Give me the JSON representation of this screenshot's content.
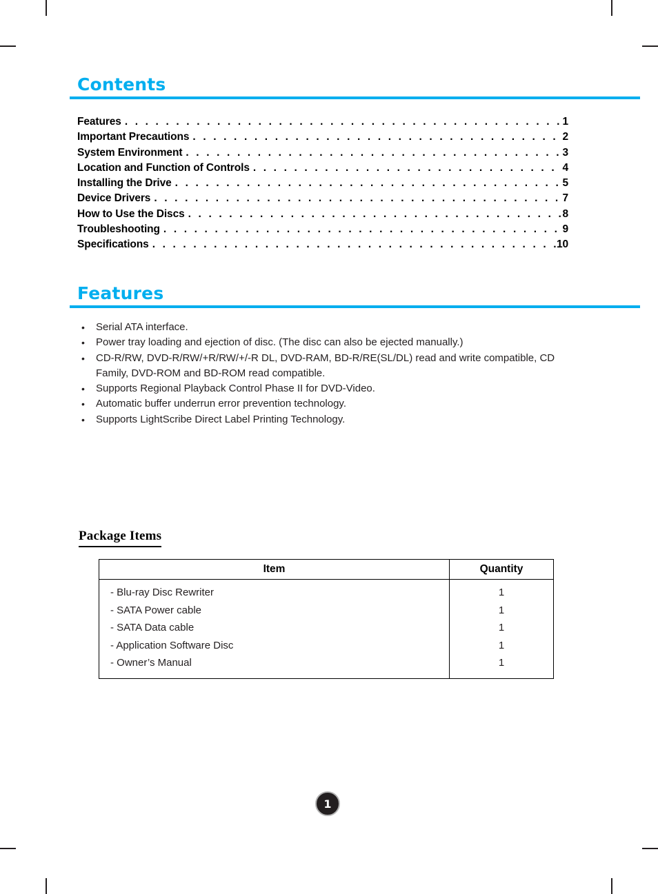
{
  "document": {
    "page_number": "1"
  },
  "contents": {
    "title": "Contents",
    "entries": [
      {
        "label": "Features",
        "dots": ". . . . . . . . . . . . . . . . . . . . . . . . . . . . . . . . . . . . . . . . . . . . . .",
        "page": "1"
      },
      {
        "label": "Important Precautions",
        "dots": ". . . . . . . . . . . . . . . . . . . . . . . . . . . . . . . . . . . . . . . . . . . . . .",
        "page": "2"
      },
      {
        "label": "System Environment",
        "dots": ". . . . . . . . . . . . . . . . . . . . . . . . . . . . . . . . . . . . . . . . . . . . . .",
        "page": "3"
      },
      {
        "label": "Location and Function of Controls",
        "dots": ". . . . . . . . . . . . . . . . . . . . . . . . . . . . . . . . . . . . . . . . . . . . . .",
        "page": "4"
      },
      {
        "label": "Installing the Drive",
        "dots": ". . . . . . . . . . . . . . . . . . . . . . . . . . . . . . . . . . . . . . . . . . . . . .",
        "page": "5"
      },
      {
        "label": "Device Drivers",
        "dots": ". . . . . . . . . . . . . . . . . . . . . . . . . . . . . . . . . . . . . . . . . . . . . .",
        "page": "7"
      },
      {
        "label": "How to Use the Discs",
        "dots": ". . . . . . . . . . . . . . . . . . . . . . . . . . . . . . . . . . . . . . . . . . . . . .",
        "page": "8"
      },
      {
        "label": "Troubleshooting",
        "dots": ". . . . . . . . . . . . . . . . . . . . . . . . . . . . . . . . . . . . . . . . . . . . . .",
        "page": "9"
      },
      {
        "label": "Specifications",
        "dots": ". . . . . . . . . . . . . . . . . . . . . . . . . . . . . . . . . . . . . . . . . . . . . .",
        "page": "10"
      }
    ]
  },
  "features": {
    "title": "Features",
    "bullet_glyph": "•",
    "items": [
      "Serial ATA interface.",
      "Power tray loading and ejection of disc. (The disc can also be ejected manually.)",
      "CD-R/RW, DVD-R/RW/+R/RW/+/-R DL, DVD-RAM, BD-R/RE(SL/DL) read and write compatible, CD Family, DVD-ROM and BD-ROM read compatible.",
      "Supports Regional Playback Control Phase II for DVD-Video.",
      "Automatic buffer underrun error prevention technology.",
      "Supports LightScribe Direct Label Printing Technology."
    ]
  },
  "package_items": {
    "heading": "Package Items",
    "columns": [
      "Item",
      "Quantity"
    ],
    "rows": [
      {
        "item": "- Blu-ray Disc Rewriter",
        "quantity": "1"
      },
      {
        "item": "- SATA Power cable",
        "quantity": "1"
      },
      {
        "item": "- SATA Data cable",
        "quantity": "1"
      },
      {
        "item": "- Application Software Disc",
        "quantity": "1"
      },
      {
        "item": "- Owner’s Manual",
        "quantity": "1"
      }
    ]
  },
  "colors": {
    "accent": "#00AEEF",
    "text": "#231f20",
    "badge_background": "#231f20",
    "badge_ring": "#b3b3b3"
  }
}
